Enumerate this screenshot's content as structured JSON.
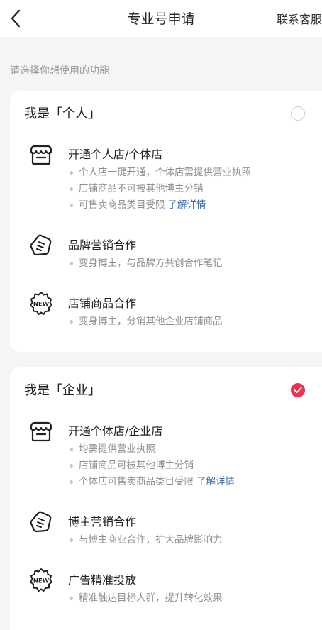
{
  "header": {
    "title": "专业号申请",
    "service": "联系客服",
    "back_icon": "chevron-left-icon"
  },
  "prompt": "请选择你想使用的功能",
  "cards": [
    {
      "title": "我是「个人」",
      "selected": false,
      "features": [
        {
          "icon": "storefront-icon",
          "title": "开通个人店/个体店",
          "bullets": [
            "个人店一键开通，个体店需提供营业执照",
            "店铺商品不可被其他博主分销",
            "可售卖商品类目受限"
          ],
          "link": "了解详情"
        },
        {
          "icon": "tag-icon",
          "title": "品牌营销合作",
          "bullets": [
            "变身博主，与品牌方共创合作笔记"
          ]
        },
        {
          "icon": "new-badge-icon",
          "title": "店铺商品合作",
          "bullets": [
            "变身博主，分销其他企业店铺商品"
          ]
        }
      ]
    },
    {
      "title": "我是「企业」",
      "selected": true,
      "features": [
        {
          "icon": "storefront-icon",
          "title": "开通个体店/企业店",
          "bullets": [
            "均需提供营业执照",
            "店铺商品可被其他博主分销",
            "个体店可售卖商品类目受限"
          ],
          "link": "了解详情"
        },
        {
          "icon": "tag-icon",
          "title": "博主营销合作",
          "bullets": [
            "与博主商业合作，扩大品牌影响力"
          ]
        },
        {
          "icon": "new-badge-icon",
          "title": "广告精准投放",
          "bullets": [
            "精准触达目标人群，提升转化效果"
          ]
        }
      ]
    }
  ],
  "colors": {
    "accent": "#f0304e",
    "link": "#3a6fb0",
    "background": "#f5f5f5"
  }
}
